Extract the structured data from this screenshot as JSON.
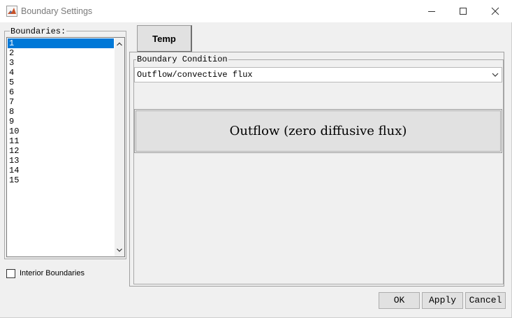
{
  "window": {
    "title": "Boundary Settings",
    "icon": "matlab-icon",
    "controls": [
      "minimize-icon",
      "maximize-icon",
      "close-icon"
    ]
  },
  "boundaries": {
    "legend": "Boundaries:",
    "items": [
      "1",
      "2",
      "3",
      "4",
      "5",
      "6",
      "7",
      "8",
      "9",
      "10",
      "11",
      "12",
      "13",
      "14",
      "15"
    ],
    "selected": "1"
  },
  "interior": {
    "label": "Interior Boundaries",
    "checked": false
  },
  "tab": {
    "label": "Temp"
  },
  "boundary_condition": {
    "legend": "Boundary Condition",
    "selected": "Outflow/convective flux",
    "description": "Outflow (zero diffusive flux)"
  },
  "buttons": {
    "ok": "OK",
    "apply": "Apply",
    "cancel": "Cancel"
  },
  "colors": {
    "selection": "#0078d7",
    "background": "#f0f0f0",
    "button_face": "#e1e1e1"
  }
}
